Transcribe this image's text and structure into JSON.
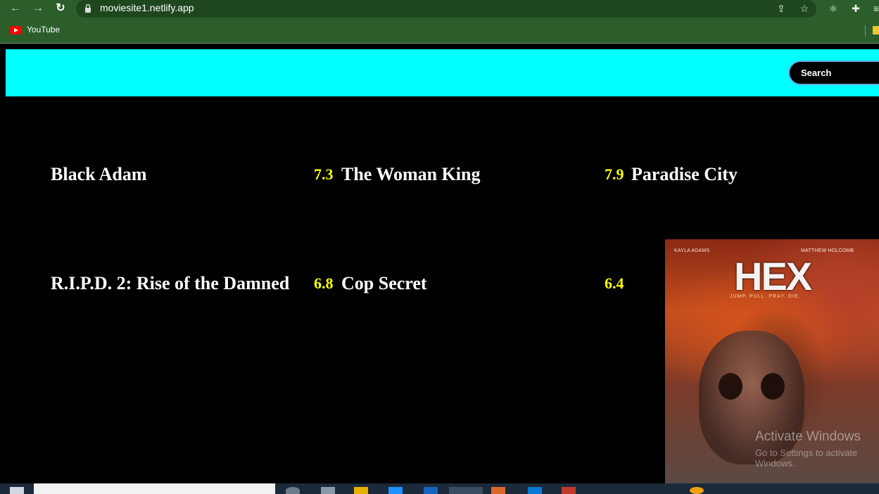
{
  "browser": {
    "url": "moviesite1.netlify.app",
    "bookmarks": [
      {
        "label": "YouTube"
      }
    ]
  },
  "header": {
    "search_placeholder": "Search"
  },
  "movies": [
    {
      "title": "Black Adam",
      "rating": "7.3"
    },
    {
      "title": "The Woman King",
      "rating": "7.9"
    },
    {
      "title": "Paradise City",
      "rating": ""
    },
    {
      "title": "R.I.P.D. 2: Rise of the Damned",
      "rating": "6.8"
    },
    {
      "title": "Cop Secret",
      "rating": "6.4"
    }
  ],
  "poster": {
    "title": "HEX",
    "credit_left": "KAYLA ADAMS",
    "credit_right": "MATTHEW HOLCOMB",
    "tagline": "JUMP. PULL. PRAY. DIE."
  },
  "watermark": {
    "line1": "Activate Windows",
    "line2": "Go to Settings to activate Windows."
  },
  "colors": {
    "header_bar": "#00ffff",
    "rating": "#ffff00",
    "chrome": "#2b5e2b"
  }
}
